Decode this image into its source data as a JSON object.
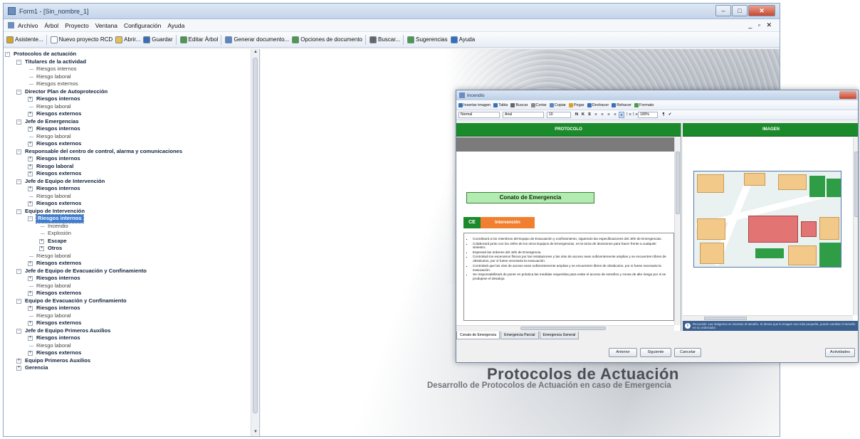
{
  "window": {
    "title": "Form1 - [Sin_nombre_1]",
    "controls": {
      "minimize": "–",
      "maximize": "□",
      "close": "✕"
    },
    "mdi_controls": "_ ▫ ✕"
  },
  "menu": [
    "Archivo",
    "Árbol",
    "Proyecto",
    "Ventana",
    "Configuración",
    "Ayuda"
  ],
  "toolbar": [
    {
      "label": "Asistente...",
      "icon": "wand-icon",
      "color": "#d9a520"
    },
    {
      "label": "Nuevo proyecto RCD",
      "icon": "new-doc-icon",
      "color": "#ffffff"
    },
    {
      "label": "Abrir...",
      "icon": "folder-icon",
      "color": "#e8c14a"
    },
    {
      "label": "Guardar",
      "icon": "save-icon",
      "color": "#3a6fb8"
    },
    {
      "label": "Editar Árbol",
      "icon": "tree-icon",
      "color": "#4a9a4a"
    },
    {
      "label": "Generar documento...",
      "icon": "document-icon",
      "color": "#5b86c4"
    },
    {
      "label": "Opciones de documento",
      "icon": "options-icon",
      "color": "#4a9a4a"
    },
    {
      "label": "Buscar...",
      "icon": "binoculars-icon",
      "color": "#666666"
    },
    {
      "label": "Sugerencias",
      "icon": "suggestions-icon",
      "color": "#4a9a4a"
    },
    {
      "label": "Ayuda",
      "icon": "help-icon",
      "color": "#2f6fc4"
    }
  ],
  "tree": [
    {
      "label": "Protocolos de actuación",
      "level": 0,
      "bold": true,
      "expander": "-"
    },
    {
      "label": "Titulares de la actividad",
      "level": 1,
      "bold": true,
      "expander": "-"
    },
    {
      "label": "Riesgos internos",
      "level": 2,
      "bold": false
    },
    {
      "label": "Riesgo laboral",
      "level": 2,
      "bold": false
    },
    {
      "label": "Riesgos externos",
      "level": 2,
      "bold": false
    },
    {
      "label": "Director Plan de Autoprotección",
      "level": 1,
      "bold": true,
      "expander": "-"
    },
    {
      "label": "Riesgos internos",
      "level": 2,
      "bold": true,
      "expander": "+"
    },
    {
      "label": "Riesgo laboral",
      "level": 2,
      "bold": false
    },
    {
      "label": "Riesgos externos",
      "level": 2,
      "bold": true,
      "expander": "+"
    },
    {
      "label": "Jefe de Emergencias",
      "level": 1,
      "bold": true,
      "expander": "-"
    },
    {
      "label": "Riesgos internos",
      "level": 2,
      "bold": true,
      "expander": "+"
    },
    {
      "label": "Riesgo laboral",
      "level": 2,
      "bold": false
    },
    {
      "label": "Riesgos externos",
      "level": 2,
      "bold": true,
      "expander": "+"
    },
    {
      "label": "Responsable del centro de control, alarma y comunicaciones",
      "level": 1,
      "bold": true,
      "expander": "-"
    },
    {
      "label": "Riesgos internos",
      "level": 2,
      "bold": true,
      "expander": "+"
    },
    {
      "label": "Riesgo laboral",
      "level": 2,
      "bold": true,
      "expander": "+"
    },
    {
      "label": "Riesgos externos",
      "level": 2,
      "bold": true,
      "expander": "+"
    },
    {
      "label": "Jefe de Equipo de Intervención",
      "level": 1,
      "bold": true,
      "expander": "-"
    },
    {
      "label": "Riesgos internos",
      "level": 2,
      "bold": true,
      "expander": "+"
    },
    {
      "label": "Riesgo laboral",
      "level": 2,
      "bold": false
    },
    {
      "label": "Riesgos externos",
      "level": 2,
      "bold": true,
      "expander": "+"
    },
    {
      "label": "Equipo de Intervención",
      "level": 1,
      "bold": true,
      "expander": "-"
    },
    {
      "label": "Riesgos internos",
      "level": 2,
      "bold": true,
      "expander": "-",
      "selected": true
    },
    {
      "label": "Incendio",
      "level": 3,
      "bold": false
    },
    {
      "label": "Explosión",
      "level": 3,
      "bold": false
    },
    {
      "label": "Escape",
      "level": 3,
      "bold": true,
      "expander": "+"
    },
    {
      "label": "Otros",
      "level": 3,
      "bold": true,
      "expander": "+"
    },
    {
      "label": "Riesgo laboral",
      "level": 2,
      "bold": false
    },
    {
      "label": "Riesgos externos",
      "level": 2,
      "bold": true,
      "expander": "+"
    },
    {
      "label": "Jefe de Equipo de Evacuación y Confinamiento",
      "level": 1,
      "bold": true,
      "expander": "-"
    },
    {
      "label": "Riesgos internos",
      "level": 2,
      "bold": true,
      "expander": "+"
    },
    {
      "label": "Riesgo laboral",
      "level": 2,
      "bold": false
    },
    {
      "label": "Riesgos externos",
      "level": 2,
      "bold": true,
      "expander": "+"
    },
    {
      "label": "Equipo de Evacuación y Confinamiento",
      "level": 1,
      "bold": true,
      "expander": "-"
    },
    {
      "label": "Riesgos internos",
      "level": 2,
      "bold": true,
      "expander": "+"
    },
    {
      "label": "Riesgo laboral",
      "level": 2,
      "bold": false
    },
    {
      "label": "Riesgos externos",
      "level": 2,
      "bold": true,
      "expander": "+"
    },
    {
      "label": "Jefe de Equipo Primeros Auxilios",
      "level": 1,
      "bold": true,
      "expander": "-"
    },
    {
      "label": "Riesgos internos",
      "level": 2,
      "bold": true,
      "expander": "+"
    },
    {
      "label": "Riesgo laboral",
      "level": 2,
      "bold": false
    },
    {
      "label": "Riesgos externos",
      "level": 2,
      "bold": true,
      "expander": "+"
    },
    {
      "label": "Equipo Primeros Auxilios",
      "level": 1,
      "bold": true,
      "expander": "+"
    },
    {
      "label": "Gerencia",
      "level": 1,
      "bold": true,
      "expander": "+"
    }
  ],
  "background": {
    "title": "Protocolos de Actuación",
    "subtitle": "Desarrollo de Protocolos de Actuación en caso de Emergencia"
  },
  "editor": {
    "title": "Incendio",
    "toolbar1": [
      {
        "label": "Insertar imagen",
        "icon": "image-icon",
        "color": "#3a6fb8"
      },
      {
        "label": "Tabla",
        "icon": "table-icon",
        "color": "#3a6fb8"
      },
      {
        "label": "Buscar",
        "icon": "search-icon",
        "color": "#666666"
      },
      {
        "label": "Cortar",
        "icon": "cut-icon",
        "color": "#888888"
      },
      {
        "label": "Copiar",
        "icon": "copy-icon",
        "color": "#5b86c4"
      },
      {
        "label": "Pegar",
        "icon": "paste-icon",
        "color": "#d9a520"
      },
      {
        "label": "Deshacer",
        "icon": "undo-icon",
        "color": "#3a6fb8"
      },
      {
        "label": "Rehacer",
        "icon": "redo-icon",
        "color": "#3a6fb8"
      },
      {
        "label": "Formato",
        "icon": "format-icon",
        "color": "#4a9a4a"
      }
    ],
    "style_combo": "Normal",
    "font_combo": "Arial",
    "size_combo": "10",
    "zoom_combo": "100%",
    "format_buttons": [
      "N",
      "K",
      "S",
      "≡",
      "≡",
      "≡",
      "≡",
      "≡",
      "⋮≡",
      "⋮≡"
    ],
    "protocol_header": "PROTOCOLO",
    "image_header": "IMAGEN",
    "conato": "Conato de Emergencia",
    "ce_badge": "CE",
    "intervencion_badge": "Intervención",
    "instructions": [
      "Coordinará a los miembros del Equipo de Evacuación y confinamiento, siguiendo las especificaciones del Jefe de Emergencias.",
      "Colaborará junto con los Jefes de los otros Equipos de Emergencias, en la toma de decisiones para hacer frente a cualquier siniestro.",
      "Esperará las órdenes del Jefe de Emergencia.",
      "Controlará los escenarios físicos por las instalaciones y las vías de acceso sean suficientemente amplias y se encuentren libres de obstáculos, por si fuese necesaria la evacuación.",
      "Controlará que las vías de acceso sean suficientemente amplias y se encuentren libres de obstáculos, por si fuese necesaria la evacuación.",
      "Se responsabilizará de poner en práctica las medidas requeridas para evitar el acceso de extraños y zonas de alto riesgo por si se produjese el desalojo."
    ],
    "info_text": "Recuerde: Las imágenes se insertan al tamaño. Si desea que la imagen sea más pequeña, puede cambiar el tamaño en su ordenador.",
    "tabs": [
      "Conato de Emergencia",
      "Emergencia Parcial",
      "Emergencia General"
    ],
    "buttons": {
      "anterior": "Anterior",
      "siguiente": "Siguiente",
      "cancel": "Cancelar",
      "actividades": "Actividades"
    }
  }
}
